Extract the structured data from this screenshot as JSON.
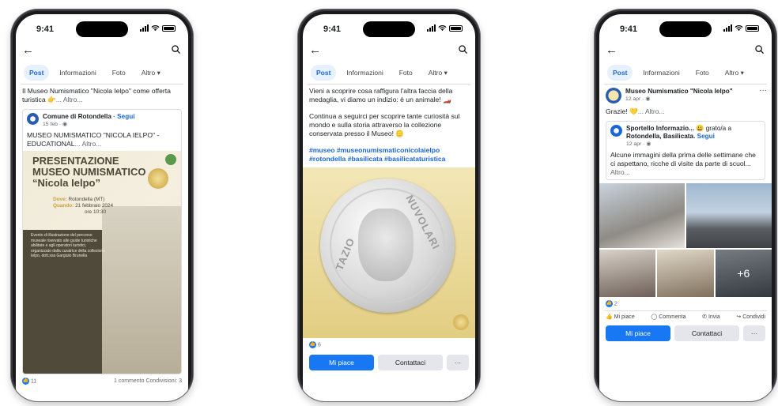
{
  "status": {
    "time": "9:41"
  },
  "tabs": [
    "Post",
    "Informazioni",
    "Foto",
    "Altro"
  ],
  "phone1": {
    "post_text": "Il Museo Numismatico \"Nicola Ielpo\" come offerta turistica 👉",
    "more": "... Altro...",
    "shared": {
      "author": "Comune di Rotondella",
      "follow": "· Segui",
      "date": "15 feb · ",
      "text": "MUSEO NUMISMATICO \"NICOLA IELPO\" - EDUCATIONAL",
      "more": "... Altro..."
    },
    "poster": {
      "title1": "PRESENTAZIONE",
      "title2": "MUSEO NUMISMATICO",
      "title3": "“Nicola Ielpo”",
      "dove_label": "Dove:",
      "dove": "Rotondella (MT)",
      "quando_label": "Quando:",
      "quando": "21 febbraio 2024",
      "ora": "ore 10:30",
      "body": "Evento di illustrazione del percorso museale riservato alle guide turistiche abilitate e agli operatori turistici, organizzato dalla curatrice della collezione Ielpo, dott.ssa Gargiulo Brunella"
    },
    "likes": "11",
    "stats": "1 commento  Condivisioni: 3"
  },
  "phone2": {
    "p1": "Vieni a scoprire cosa raffigura l'altra faccia della medaglia, vi diamo un indizio: è un animale! 🏎️",
    "p2": "Continua a seguirci per scoprire tante curiosità sul mondo e sulla storia attraverso la collezione conservata presso il Museo! 🪙",
    "hashtags": "#museo #museonumismaticonicolaielpo #rotondella #basilicata #basilicataturistica",
    "coin_name1": "TAZIO",
    "coin_name2": "NUVOLARI",
    "likes": "6",
    "like_btn": "Mi piace",
    "contact_btn": "Contattaci",
    "more_btn": "···"
  },
  "phone3": {
    "author": "Museo Numismatico \"Nicola Ielpo\"",
    "date": "12 apr · ",
    "text": "Grazie! 💛",
    "more": "... Altro...",
    "shared": {
      "author": "Sportello Informazio...",
      "mid": " 😀 grato/a a ",
      "target": "Rotondella, Basilicata",
      "follow": ". Segui",
      "date": "12 apr · ",
      "text": "Alcune immagini della prima delle settimane che ci aspettano, ricche di visite da parte di scuol...",
      "more": " Altro..."
    },
    "plus": "+6",
    "likes": "2",
    "actions": [
      "Mi piace",
      "Commenta",
      "Invia",
      "Condividi"
    ],
    "like_btn": "Mi piace",
    "contact_btn": "Contattaci",
    "more_btn": "···"
  },
  "colors": {
    "accent": "#1877f2",
    "link": "#1a66d6"
  }
}
